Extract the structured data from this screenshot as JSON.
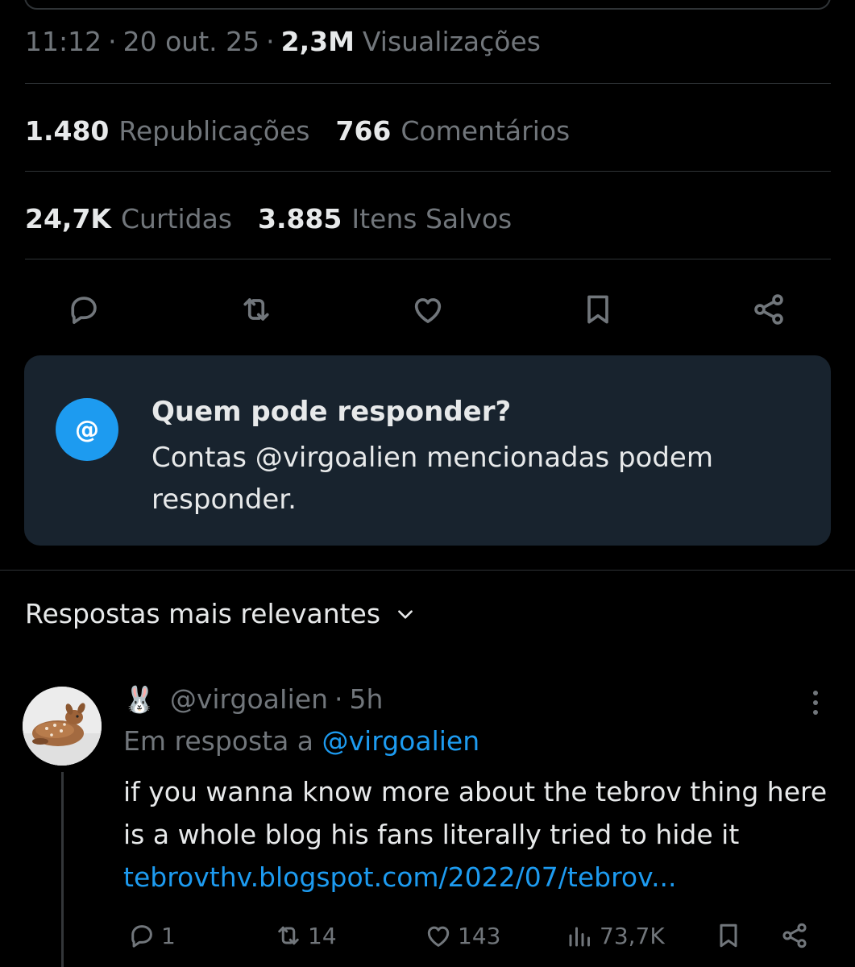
{
  "tweet_meta": {
    "time": "11:12",
    "date": "20 out. 25",
    "views_count": "2,3M",
    "views_label": "Visualizações"
  },
  "stats": {
    "reposts_count": "1.480",
    "reposts_label": "Republicações",
    "comments_count": "766",
    "comments_label": "Comentários",
    "likes_count": "24,7K",
    "likes_label": "Curtidas",
    "saves_count": "3.885",
    "saves_label": "Itens Salvos"
  },
  "action_bar": {
    "icons": [
      "reply-icon",
      "repost-icon",
      "like-icon",
      "bookmark-icon",
      "share-icon"
    ]
  },
  "reply_restriction": {
    "icon_label": "@",
    "title": "Quem pode responder?",
    "description": "Contas @virgoalien mencionadas podem responder."
  },
  "replies_sort": {
    "label": "Respostas mais relevantes"
  },
  "reply_post": {
    "emoji": "🐰",
    "handle": "@virgoaIien",
    "time": "5h",
    "reply_to_prefix": "Em resposta a",
    "reply_to_handle": "@virgoalien",
    "text": "if you wanna know more about the tebrov thing here is a whole blog his fans literally tried to hide it",
    "link": "tebrovthv.blogspot.com/2022/07/tebrov...",
    "replies": "1",
    "reposts": "14",
    "likes": "143",
    "views": "73,7K"
  },
  "colors": {
    "background": "#000000",
    "text_primary": "#e7e9ea",
    "text_secondary": "#71767b",
    "accent_blue": "#1d9bf0",
    "card_background": "#18232e",
    "divider": "#2f3336"
  }
}
